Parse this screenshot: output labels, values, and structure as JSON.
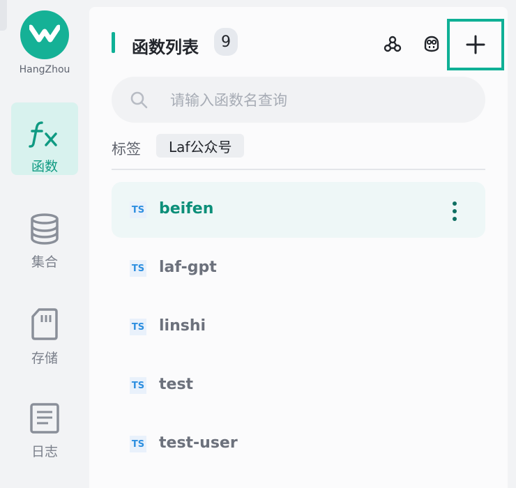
{
  "sidebar": {
    "region": "HangZhou",
    "items": [
      {
        "label": "函数",
        "icon": "function-icon",
        "active": true
      },
      {
        "label": "集合",
        "icon": "database-icon",
        "active": false
      },
      {
        "label": "存储",
        "icon": "storage-icon",
        "active": false
      },
      {
        "label": "日志",
        "icon": "logs-icon",
        "active": false
      }
    ]
  },
  "panel": {
    "title": "函数列表",
    "count": "9",
    "search": {
      "placeholder": "请输入函数名查询",
      "value": ""
    },
    "tags_label": "标签",
    "tags": [
      "Laf公众号"
    ],
    "functions": [
      {
        "lang": "TS",
        "name": "beifen",
        "active": true
      },
      {
        "lang": "TS",
        "name": "laf-gpt",
        "active": false
      },
      {
        "lang": "TS",
        "name": "linshi",
        "active": false
      },
      {
        "lang": "TS",
        "name": "test",
        "active": false
      },
      {
        "lang": "TS",
        "name": "test-user",
        "active": false
      }
    ]
  },
  "colors": {
    "accent": "#0fb096",
    "active_bg": "#d8f2ee",
    "ts": "#2d8fe0"
  }
}
